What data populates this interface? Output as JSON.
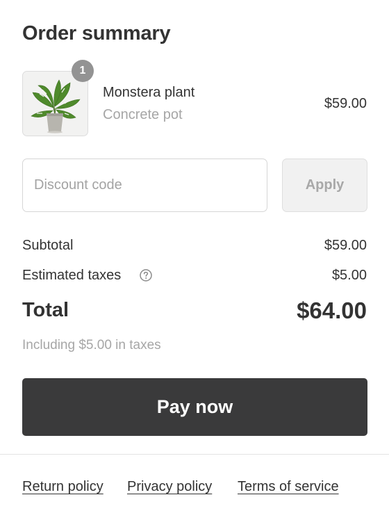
{
  "summary": {
    "title": "Order summary"
  },
  "line_item": {
    "quantity": "1",
    "name": "Monstera plant",
    "variant": "Concrete pot",
    "price": "$59.00",
    "image_icon": "monstera-plant-image"
  },
  "discount": {
    "placeholder": "Discount code",
    "value": "",
    "apply_label": "Apply"
  },
  "totals": {
    "subtotal_label": "Subtotal",
    "subtotal_value": "$59.00",
    "taxes_label": "Estimated taxes",
    "taxes_help_icon": "question-circle-icon",
    "taxes_value": "$5.00",
    "total_label": "Total",
    "total_value": "$64.00",
    "tax_note": "Including $5.00 in taxes"
  },
  "actions": {
    "pay_label": "Pay now"
  },
  "footer": {
    "links": [
      "Return policy",
      "Privacy policy",
      "Terms of service"
    ]
  },
  "colors": {
    "primary_button": "#3a3a3b",
    "muted_text": "#a6a6a6",
    "badge": "#939393"
  }
}
